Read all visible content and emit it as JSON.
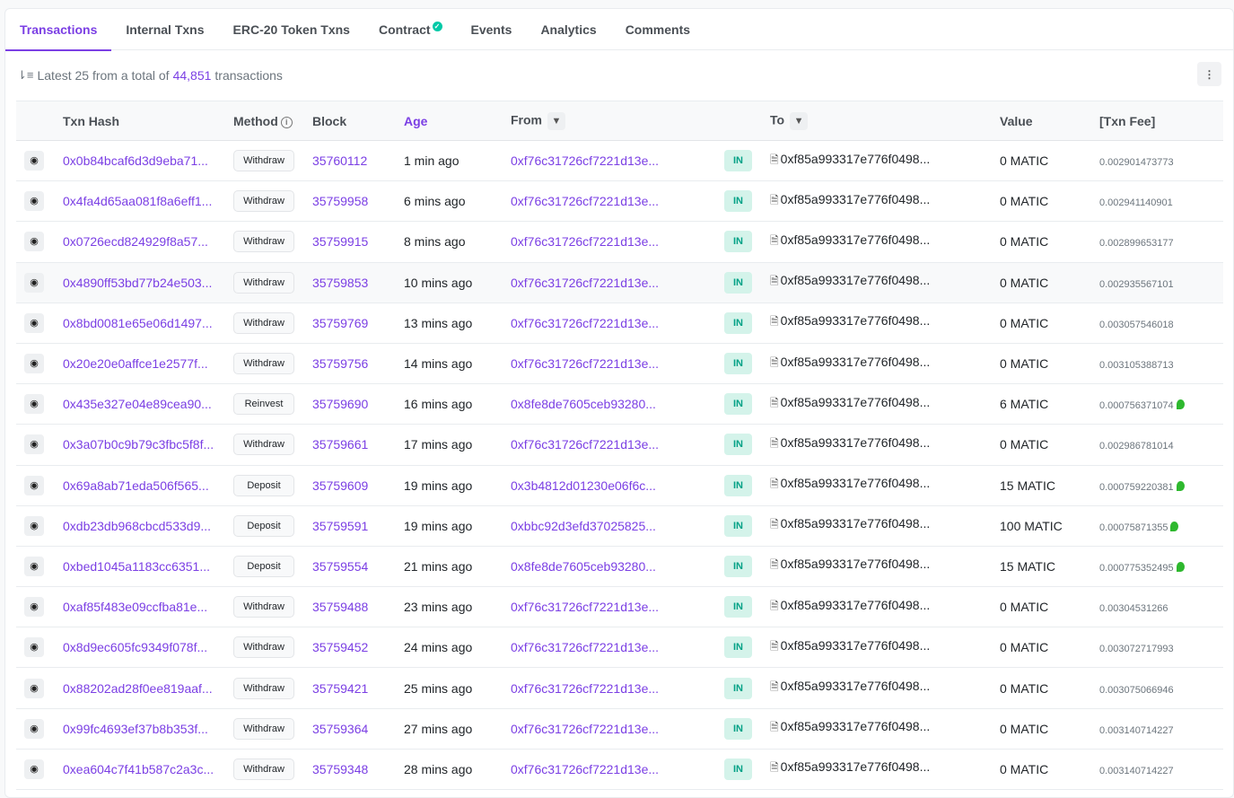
{
  "tabs": [
    {
      "label": "Transactions"
    },
    {
      "label": "Internal Txns"
    },
    {
      "label": "ERC-20 Token Txns"
    },
    {
      "label": "Contract"
    },
    {
      "label": "Events"
    },
    {
      "label": "Analytics"
    },
    {
      "label": "Comments"
    }
  ],
  "summary": {
    "prefix": "Latest 25 from a total of",
    "count": "44,851",
    "suffix": "transactions"
  },
  "headers": {
    "txn_hash": "Txn Hash",
    "method": "Method",
    "block": "Block",
    "age": "Age",
    "from": "From",
    "to": "To",
    "value": "Value",
    "fee": "[Txn Fee]"
  },
  "rows": [
    {
      "hash": "0x0b84bcaf6d3d9eba71...",
      "method": "Withdraw",
      "block": "35760112",
      "age": "1 min ago",
      "from": "0xf76c31726cf7221d13e...",
      "dir": "IN",
      "to": "0xf85a993317e776f0498...",
      "value": "0 MATIC",
      "fee": "0.002901473773",
      "leaf": false
    },
    {
      "hash": "0x4fa4d65aa081f8a6eff1...",
      "method": "Withdraw",
      "block": "35759958",
      "age": "6 mins ago",
      "from": "0xf76c31726cf7221d13e...",
      "dir": "IN",
      "to": "0xf85a993317e776f0498...",
      "value": "0 MATIC",
      "fee": "0.002941140901",
      "leaf": false
    },
    {
      "hash": "0x0726ecd824929f8a57...",
      "method": "Withdraw",
      "block": "35759915",
      "age": "8 mins ago",
      "from": "0xf76c31726cf7221d13e...",
      "dir": "IN",
      "to": "0xf85a993317e776f0498...",
      "value": "0 MATIC",
      "fee": "0.002899653177",
      "leaf": false
    },
    {
      "hash": "0x4890ff53bd77b24e503...",
      "method": "Withdraw",
      "block": "35759853",
      "age": "10 mins ago",
      "from": "0xf76c31726cf7221d13e...",
      "dir": "IN",
      "to": "0xf85a993317e776f0498...",
      "value": "0 MATIC",
      "fee": "0.002935567101",
      "leaf": false
    },
    {
      "hash": "0x8bd0081e65e06d1497...",
      "method": "Withdraw",
      "block": "35759769",
      "age": "13 mins ago",
      "from": "0xf76c31726cf7221d13e...",
      "dir": "IN",
      "to": "0xf85a993317e776f0498...",
      "value": "0 MATIC",
      "fee": "0.003057546018",
      "leaf": false
    },
    {
      "hash": "0x20e20e0affce1e2577f...",
      "method": "Withdraw",
      "block": "35759756",
      "age": "14 mins ago",
      "from": "0xf76c31726cf7221d13e...",
      "dir": "IN",
      "to": "0xf85a993317e776f0498...",
      "value": "0 MATIC",
      "fee": "0.003105388713",
      "leaf": false
    },
    {
      "hash": "0x435e327e04e89cea90...",
      "method": "Reinvest",
      "block": "35759690",
      "age": "16 mins ago",
      "from": "0x8fe8de7605ceb93280...",
      "dir": "IN",
      "to": "0xf85a993317e776f0498...",
      "value": "6 MATIC",
      "fee": "0.000756371074",
      "leaf": true
    },
    {
      "hash": "0x3a07b0c9b79c3fbc5f8f...",
      "method": "Withdraw",
      "block": "35759661",
      "age": "17 mins ago",
      "from": "0xf76c31726cf7221d13e...",
      "dir": "IN",
      "to": "0xf85a993317e776f0498...",
      "value": "0 MATIC",
      "fee": "0.002986781014",
      "leaf": false
    },
    {
      "hash": "0x69a8ab71eda506f565...",
      "method": "Deposit",
      "block": "35759609",
      "age": "19 mins ago",
      "from": "0x3b4812d01230e06f6c...",
      "dir": "IN",
      "to": "0xf85a993317e776f0498...",
      "value": "15 MATIC",
      "fee": "0.000759220381",
      "leaf": true
    },
    {
      "hash": "0xdb23db968cbcd533d9...",
      "method": "Deposit",
      "block": "35759591",
      "age": "19 mins ago",
      "from": "0xbbc92d3efd37025825...",
      "dir": "IN",
      "to": "0xf85a993317e776f0498...",
      "value": "100 MATIC",
      "fee": "0.00075871355",
      "leaf": true
    },
    {
      "hash": "0xbed1045a1183cc6351...",
      "method": "Deposit",
      "block": "35759554",
      "age": "21 mins ago",
      "from": "0x8fe8de7605ceb93280...",
      "dir": "IN",
      "to": "0xf85a993317e776f0498...",
      "value": "15 MATIC",
      "fee": "0.000775352495",
      "leaf": true
    },
    {
      "hash": "0xaf85f483e09ccfba81e...",
      "method": "Withdraw",
      "block": "35759488",
      "age": "23 mins ago",
      "from": "0xf76c31726cf7221d13e...",
      "dir": "IN",
      "to": "0xf85a993317e776f0498...",
      "value": "0 MATIC",
      "fee": "0.00304531266",
      "leaf": false
    },
    {
      "hash": "0x8d9ec605fc9349f078f...",
      "method": "Withdraw",
      "block": "35759452",
      "age": "24 mins ago",
      "from": "0xf76c31726cf7221d13e...",
      "dir": "IN",
      "to": "0xf85a993317e776f0498...",
      "value": "0 MATIC",
      "fee": "0.003072717993",
      "leaf": false
    },
    {
      "hash": "0x88202ad28f0ee819aaf...",
      "method": "Withdraw",
      "block": "35759421",
      "age": "25 mins ago",
      "from": "0xf76c31726cf7221d13e...",
      "dir": "IN",
      "to": "0xf85a993317e776f0498...",
      "value": "0 MATIC",
      "fee": "0.003075066946",
      "leaf": false
    },
    {
      "hash": "0x99fc4693ef37b8b353f...",
      "method": "Withdraw",
      "block": "35759364",
      "age": "27 mins ago",
      "from": "0xf76c31726cf7221d13e...",
      "dir": "IN",
      "to": "0xf85a993317e776f0498...",
      "value": "0 MATIC",
      "fee": "0.003140714227",
      "leaf": false
    },
    {
      "hash": "0xea604c7f41b587c2a3c...",
      "method": "Withdraw",
      "block": "35759348",
      "age": "28 mins ago",
      "from": "0xf76c31726cf7221d13e...",
      "dir": "IN",
      "to": "0xf85a993317e776f0498...",
      "value": "0 MATIC",
      "fee": "0.003140714227",
      "leaf": false
    }
  ]
}
